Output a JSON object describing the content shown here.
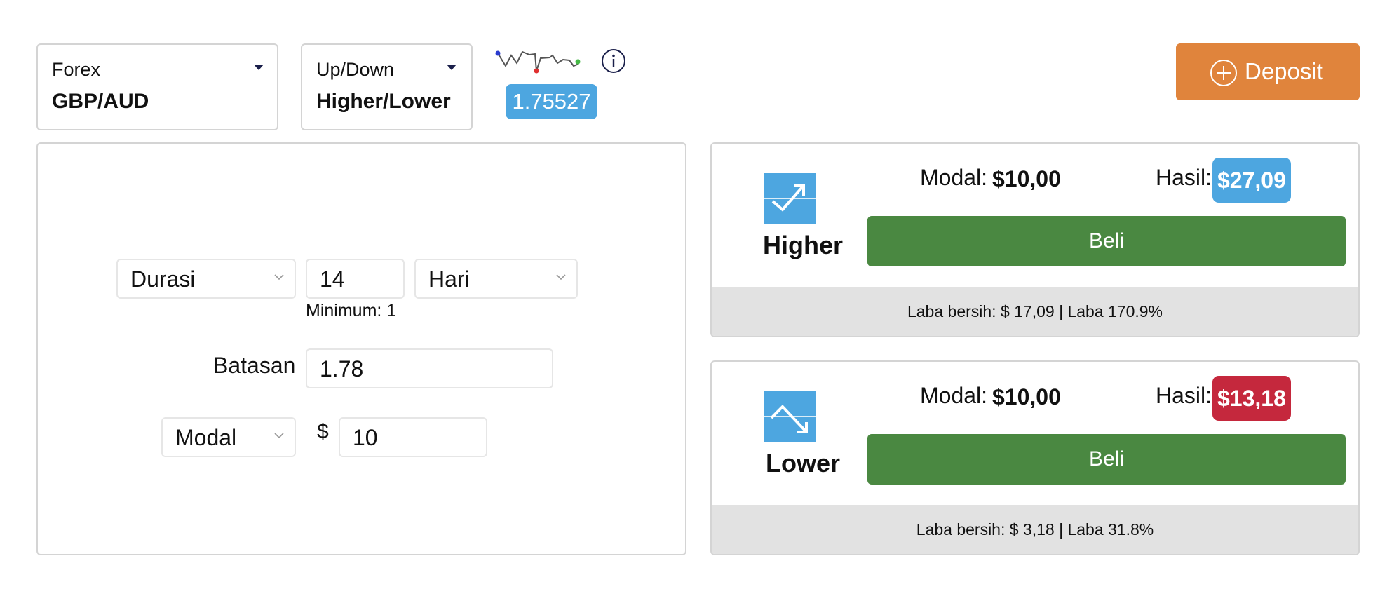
{
  "top_bar": {
    "category": {
      "label": "Forex",
      "value": "GBP/AUD"
    },
    "option_type": {
      "label": "Up/Down",
      "value": "Higher/Lower"
    },
    "current_price": "1.75527",
    "deposit_label": "Deposit"
  },
  "form": {
    "duration_select": "Durasi",
    "duration_value": "14",
    "duration_unit": "Hari",
    "duration_hint": "Minimum: 1",
    "barrier_label": "Batasan",
    "barrier_value": "1.78",
    "stake_select": "Modal",
    "currency_symbol": "$",
    "stake_value": "10"
  },
  "contracts": [
    {
      "label": "Higher",
      "stake_label": "Modal:",
      "stake_value": "$10,00",
      "payout_label": "Hasil:",
      "payout_value": "$27,09",
      "buy_label": "Beli",
      "footer": "Laba bersih: $ 17,09 | Laba 170.9%",
      "badge_color": "#4da6e0"
    },
    {
      "label": "Lower",
      "stake_label": "Modal:",
      "stake_value": "$10,00",
      "payout_label": "Hasil:",
      "payout_value": "$13,18",
      "buy_label": "Beli",
      "footer": "Laba bersih: $ 3,18 | Laba 31.8%",
      "badge_color": "#c5283d"
    }
  ],
  "colors": {
    "accent_blue": "#4da6e0",
    "deposit_orange": "#e0843c",
    "buy_green": "#4a8841",
    "loss_red": "#c5283d"
  }
}
